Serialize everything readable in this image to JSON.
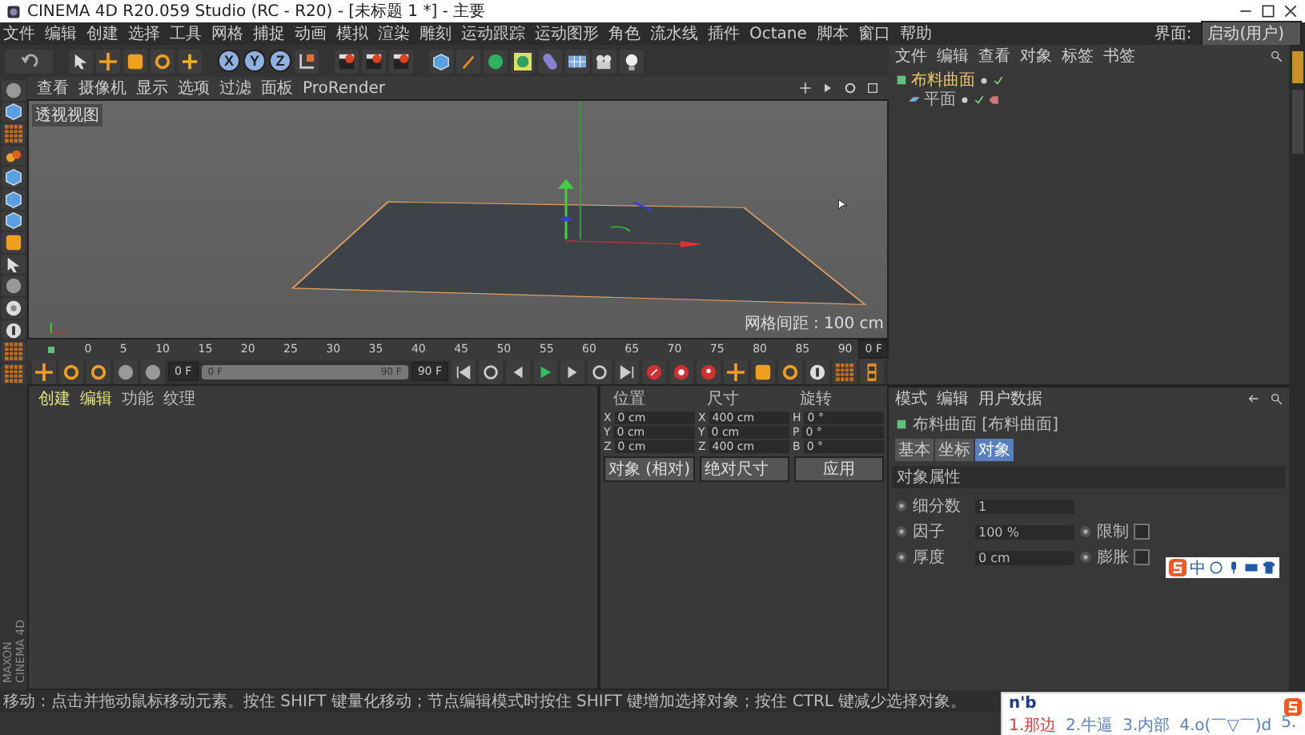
{
  "window": {
    "title": "CINEMA 4D R20.059 Studio (RC - R20) - [未标题 1 *] - 主要"
  },
  "menu_bar": {
    "items": [
      "文件",
      "编辑",
      "创建",
      "选择",
      "工具",
      "网格",
      "捕捉",
      "动画",
      "模拟",
      "渲染",
      "雕刻",
      "运动跟踪",
      "运动图形",
      "角色",
      "流水线",
      "插件",
      "Octane",
      "脚本",
      "窗口",
      "帮助"
    ],
    "layout_label": "界面:",
    "layout_value": "启动(用户)"
  },
  "toolbar": {
    "axis_buttons": [
      {
        "label": "X",
        "on": true
      },
      {
        "label": "Y",
        "on": true
      },
      {
        "label": "Z",
        "on": true
      }
    ]
  },
  "viewport": {
    "menu": [
      "查看",
      "摄像机",
      "显示",
      "选项",
      "过滤",
      "面板",
      "ProRender"
    ],
    "view_label": "透视视图",
    "grid_label": "网格间距 : 100 cm"
  },
  "timeline": {
    "ticks": [
      "0",
      "5",
      "10",
      "15",
      "20",
      "25",
      "30",
      "35",
      "40",
      "45",
      "50",
      "55",
      "60",
      "65",
      "70",
      "75",
      "80",
      "85",
      "90"
    ],
    "frame_field": "0 F",
    "start_field": "0 F",
    "range": {
      "start": "0 F",
      "end": "90 F",
      "level": 1
    },
    "end_field": "90 F"
  },
  "object_manager": {
    "menu": [
      "文件",
      "编辑",
      "查看",
      "对象",
      "标签",
      "书签"
    ],
    "objects": [
      {
        "name": "布料曲面",
        "selected": true,
        "children": [
          {
            "name": "平面",
            "selected": false
          }
        ]
      }
    ]
  },
  "attributes": {
    "menu": [
      "模式",
      "编辑",
      "用户数据"
    ],
    "object_title": "布料曲面 [布料曲面]",
    "tabs": [
      {
        "label": "基本",
        "selected": false
      },
      {
        "label": "坐标",
        "selected": false
      },
      {
        "label": "对象",
        "selected": true
      }
    ],
    "section": "对象属性",
    "fields": [
      {
        "label": "细分数",
        "value": "1"
      },
      {
        "label": "因子",
        "value": "100 %",
        "extra_label": "限制",
        "checked": false
      },
      {
        "label": "厚度",
        "value": "0 cm",
        "extra_label": "膨胀",
        "checked": false
      }
    ]
  },
  "materials": {
    "menu": [
      "创建",
      "编辑",
      "功能",
      "纹理"
    ]
  },
  "brand": {
    "lines": [
      "MAXON",
      "CINEMA 4D"
    ]
  },
  "coordinates": {
    "headers": [
      "位置",
      "尺寸",
      "旋转"
    ],
    "rows": [
      [
        {
          "axis": "X",
          "value": "0 cm"
        },
        {
          "axis": "X",
          "value": "400 cm"
        },
        {
          "axis": "H",
          "value": "0 °"
        }
      ],
      [
        {
          "axis": "Y",
          "value": "0 cm"
        },
        {
          "axis": "Y",
          "value": "0 cm"
        },
        {
          "axis": "P",
          "value": "0 °"
        }
      ],
      [
        {
          "axis": "Z",
          "value": "0 cm"
        },
        {
          "axis": "Z",
          "value": "400 cm"
        },
        {
          "axis": "B",
          "value": "0 °"
        }
      ]
    ],
    "dropdowns": [
      "对象 (相对)",
      "绝对尺寸"
    ],
    "apply": "应用"
  },
  "status_bar": {
    "text": "移动：点击并拖动鼠标移动元素。按住 SHIFT 键量化移动；节点编辑模式时按住 SHIFT 键增加选择对象；按住 CTRL 键减少选择对象。"
  },
  "ime_toolbar": {
    "mode": "中"
  },
  "ime": {
    "input": "n'b",
    "candidates": [
      {
        "label": "1.那边",
        "selected": true
      },
      {
        "label": "2.牛逼",
        "selected": false
      },
      {
        "label": "3.内部",
        "selected": false
      },
      {
        "label": "4.o(￣▽￣)d",
        "selected": false
      },
      {
        "label": "5.",
        "selected": false
      }
    ]
  }
}
